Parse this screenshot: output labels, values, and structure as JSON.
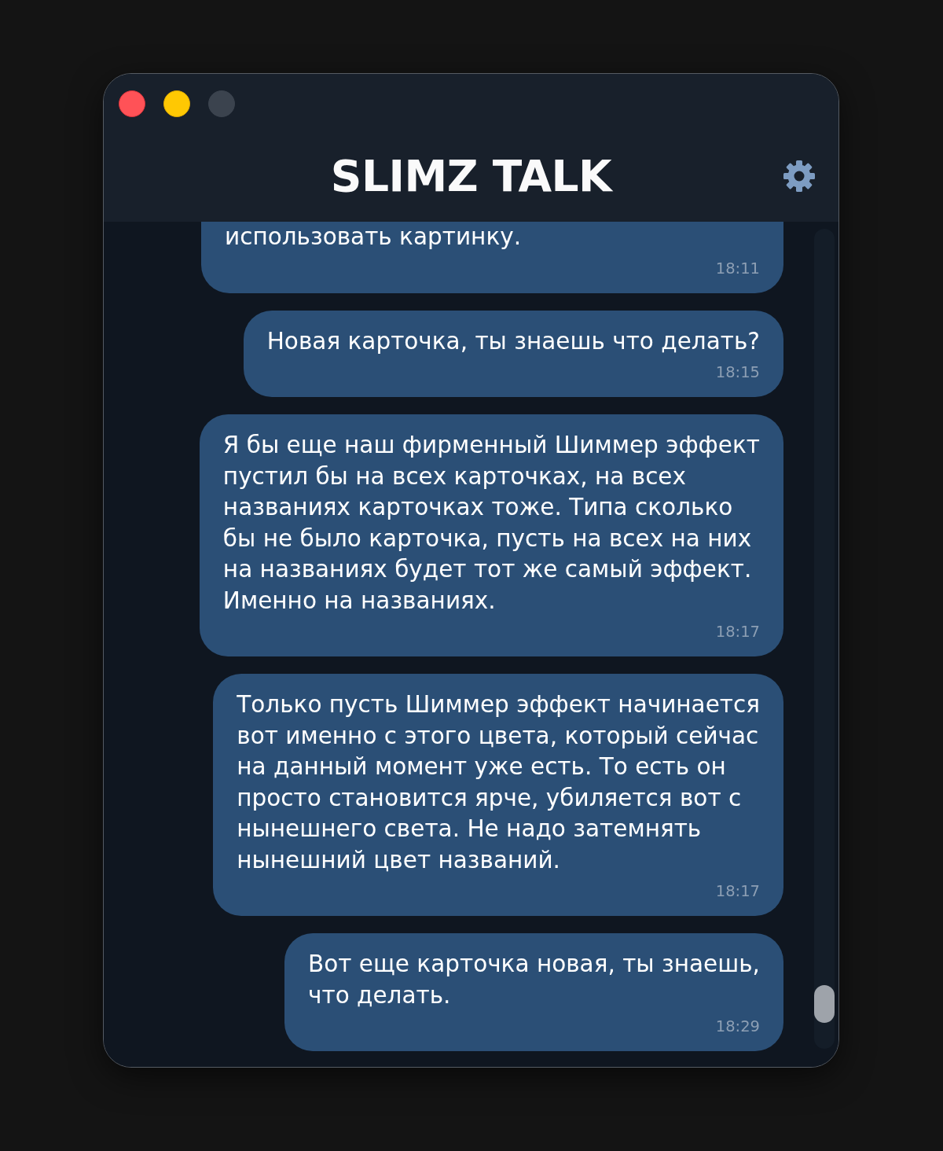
{
  "window": {
    "title": "SLIMZ TALK",
    "buttons": [
      {
        "kind": "close",
        "disabled": false
      },
      {
        "kind": "minimize",
        "disabled": false
      },
      {
        "kind": "zoom",
        "disabled": true
      }
    ]
  },
  "messages": [
    {
      "text": "использовать картинку.",
      "time": "18:11"
    },
    {
      "text": "Новая карточка, ты знаешь что делать?",
      "time": "18:15"
    },
    {
      "text": "Я бы еще наш фирменный Шиммер эффект\nпустил бы на всех карточках, на всех\nназваниях карточках тоже. Типа сколько\nбы не было карточка, пусть на всех на них\nна названиях будет тот же самый эффект.\nИменно на названиях.",
      "time": "18:17"
    },
    {
      "text": "Только пусть Шиммер эффект начинается\nвот именно с этого цвета, который сейчас\nна данный момент уже есть. То есть он\nпросто становится ярче, убиляется вот с\nнынешнего света. Не надо затемнять\nнынешний цвет названий.",
      "time": "18:17"
    },
    {
      "text": "Вот еще карточка новая, ты знаешь,\nчто делать.",
      "time": "18:29"
    }
  ]
}
